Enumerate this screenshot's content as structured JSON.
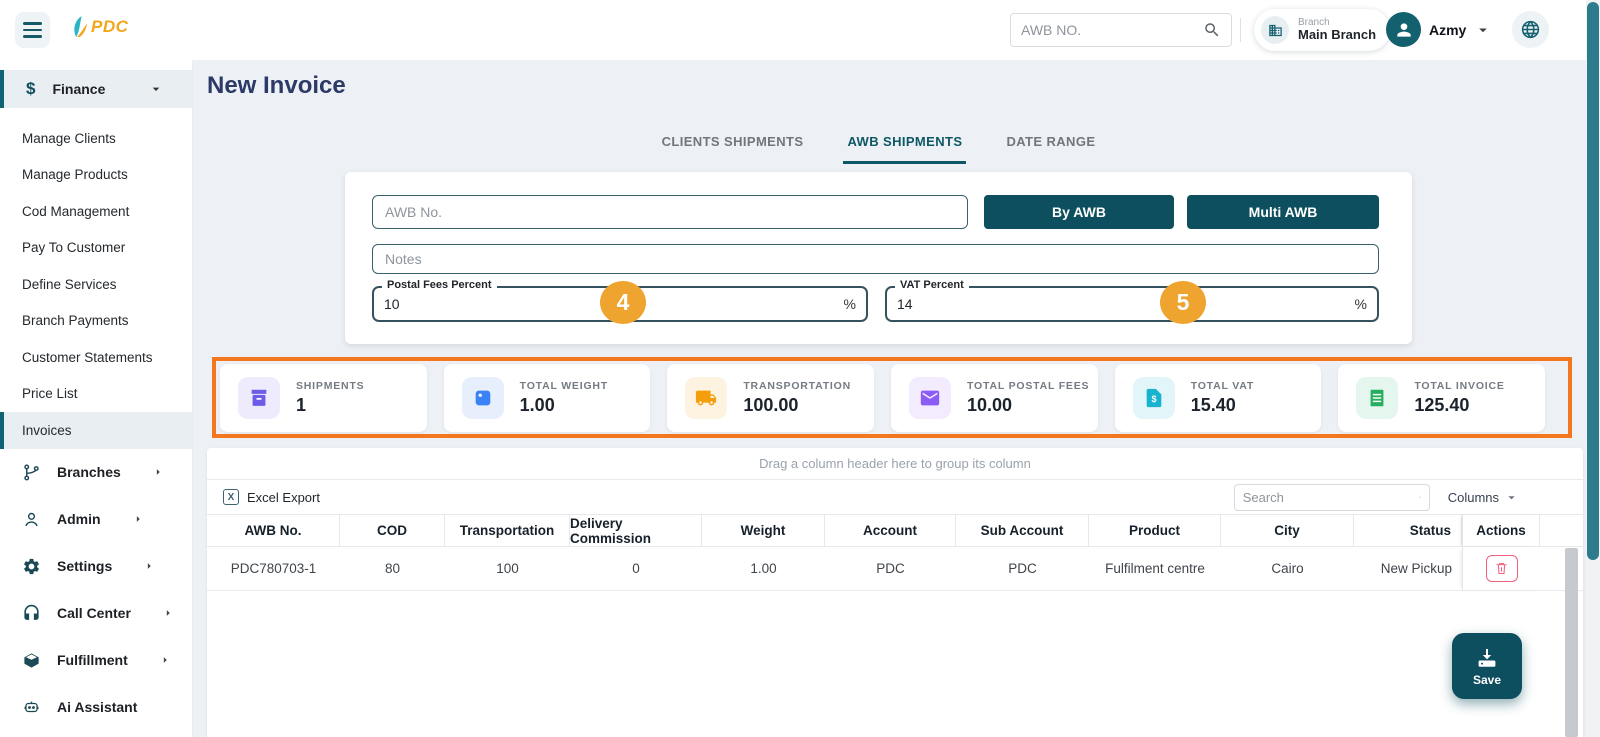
{
  "header": {
    "logo_text": "PDC",
    "search_placeholder": "AWB NO.",
    "branch_label": "Branch",
    "branch_name": "Main Branch",
    "user_name": "Azmy"
  },
  "sidebar": {
    "finance_label": "Finance",
    "finance_items": [
      "Manage Clients",
      "Manage Products",
      "Cod Management",
      "Pay To Customer",
      "Define Services",
      "Branch Payments",
      "Customer Statements",
      "Price List",
      "Invoices"
    ],
    "active_item": "Invoices",
    "groups": [
      {
        "label": "Branches"
      },
      {
        "label": "Admin"
      },
      {
        "label": "Settings"
      },
      {
        "label": "Call Center"
      },
      {
        "label": "Fulfillment"
      },
      {
        "label": "Ai Assistant"
      }
    ]
  },
  "page": {
    "title": "New Invoice"
  },
  "tabs": [
    {
      "label": "CLIENTS SHIPMENTS",
      "active": false
    },
    {
      "label": "AWB SHIPMENTS",
      "active": true
    },
    {
      "label": "DATE RANGE",
      "active": false
    }
  ],
  "form": {
    "awb_placeholder": "AWB No.",
    "by_awb_button": "By AWB",
    "multi_awb_button": "Multi AWB",
    "notes_placeholder": "Notes",
    "postal_fees": {
      "label": "Postal Fees Percent",
      "value": "10",
      "suffix": "%",
      "step_badge": "4"
    },
    "vat": {
      "label": "VAT Percent",
      "value": "14",
      "suffix": "%",
      "step_badge": "5"
    }
  },
  "summary_cards": [
    {
      "label": "SHIPMENTS",
      "value": "1",
      "icon": "archive-box-icon",
      "icon_color": "#6c5ce7",
      "icon_bg": "#eeecfc"
    },
    {
      "label": "TOTAL WEIGHT",
      "value": "1.00",
      "icon": "package-icon",
      "icon_color": "#3b82f6",
      "icon_bg": "#e7effd"
    },
    {
      "label": "TRANSPORTATION",
      "value": "100.00",
      "icon": "truck-icon",
      "icon_color": "#f59e0b",
      "icon_bg": "#fdf3e0"
    },
    {
      "label": "TOTAL POSTAL FEES",
      "value": "10.00",
      "icon": "envelope-icon",
      "icon_color": "#8b5cf6",
      "icon_bg": "#f2ecfe"
    },
    {
      "label": "TOTAL VAT",
      "value": "15.40",
      "icon": "vat-document-icon",
      "icon_color": "#18b3ce",
      "icon_bg": "#e2f6fa"
    },
    {
      "label": "TOTAL INVOICE",
      "value": "125.40",
      "icon": "receipt-icon",
      "icon_color": "#27ae60",
      "icon_bg": "#e4f6ed"
    }
  ],
  "table": {
    "group_hint": "Drag a column header here to group its column",
    "excel_export_label": "Excel Export",
    "search_placeholder": "Search",
    "columns_label": "Columns",
    "headers": [
      "AWB No.",
      "COD",
      "Transportation",
      "Delivery Commission",
      "Weight",
      "Account",
      "Sub Account",
      "Product",
      "City",
      "Status",
      "Actions"
    ],
    "rows": [
      [
        "PDC780703-1",
        "80",
        "100",
        "0",
        "1.00",
        "PDC",
        "PDC",
        "Fulfilment centre",
        "Cairo",
        "New Pickup"
      ]
    ]
  },
  "save_label": "Save",
  "colors": {
    "accent_teal": "#0d4f5e",
    "annotation_orange": "#f4771f",
    "badge_orange": "#efa430",
    "delete_pink": "#f1607c",
    "active_tab_teal": "#0d5864",
    "scrollbar_teal": "#2d7b8c"
  }
}
